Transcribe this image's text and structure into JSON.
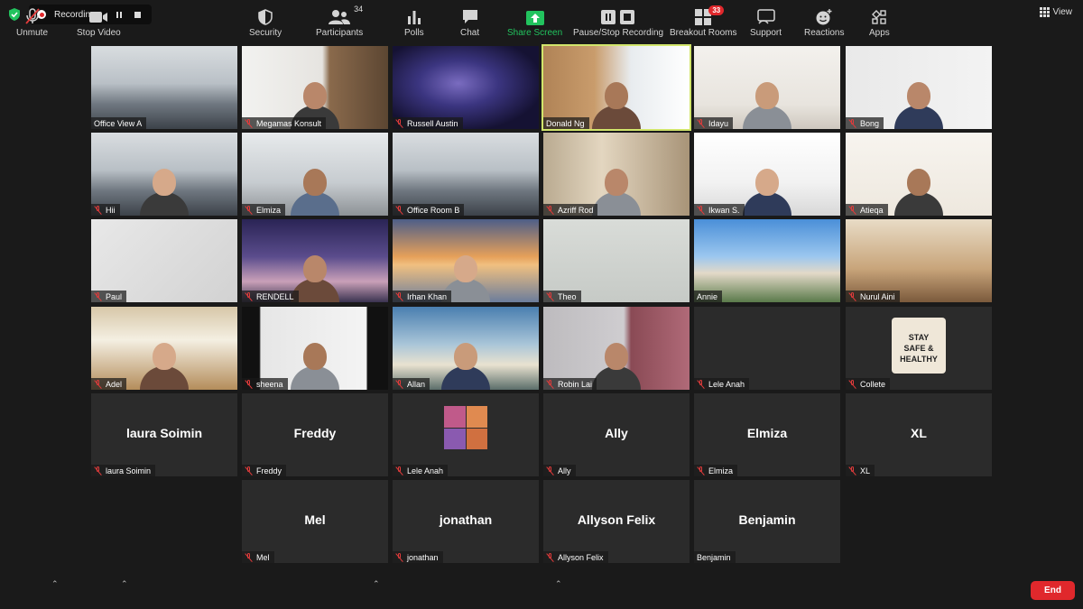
{
  "top": {
    "recording_label": "Recording...",
    "view_label": "View"
  },
  "participants": [
    {
      "name": "Office View A",
      "muted": false,
      "big": "",
      "scene": "office"
    },
    {
      "name": "Megamas Konsult",
      "muted": true,
      "big": "",
      "scene": "books"
    },
    {
      "name": "Russell Austin",
      "muted": true,
      "big": "",
      "scene": "galaxy"
    },
    {
      "name": "Donald Ng",
      "muted": false,
      "big": "",
      "scene": "man",
      "active": true
    },
    {
      "name": "Idayu",
      "muted": true,
      "big": "",
      "scene": "shelf"
    },
    {
      "name": "Bong",
      "muted": true,
      "big": "",
      "scene": "monkey"
    },
    {
      "name": "Hii",
      "muted": true,
      "big": "",
      "scene": "office"
    },
    {
      "name": "Elmiza",
      "muted": true,
      "big": "",
      "scene": "mask"
    },
    {
      "name": "Office Room B",
      "muted": true,
      "big": "",
      "scene": "office"
    },
    {
      "name": "Azriff Rod",
      "muted": true,
      "big": "",
      "scene": "street"
    },
    {
      "name": "Ikwan S.",
      "muted": true,
      "big": "",
      "scene": "white"
    },
    {
      "name": "Atieqa",
      "muted": true,
      "big": "",
      "scene": "lamps"
    },
    {
      "name": "Paul",
      "muted": true,
      "big": "",
      "scene": "ceiling"
    },
    {
      "name": "RENDELL",
      "muted": true,
      "big": "",
      "scene": "night"
    },
    {
      "name": "Irhan Khan",
      "muted": true,
      "big": "",
      "scene": "bridge"
    },
    {
      "name": "Theo",
      "muted": true,
      "big": "",
      "scene": "wall"
    },
    {
      "name": "Annie",
      "muted": false,
      "big": "",
      "scene": "villa"
    },
    {
      "name": "Nurul Aini",
      "muted": true,
      "big": "",
      "scene": "room"
    },
    {
      "name": "Adel",
      "muted": true,
      "big": "",
      "scene": "japanese"
    },
    {
      "name": "sheena",
      "muted": true,
      "big": "",
      "scene": "hijab"
    },
    {
      "name": "Allan",
      "muted": true,
      "big": "",
      "scene": "sky"
    },
    {
      "name": "Robin Lai",
      "muted": true,
      "big": "",
      "scene": "curtain"
    },
    {
      "name": "Lele Anah",
      "muted": true,
      "big": "",
      "scene": "blank"
    },
    {
      "name": "Collete",
      "muted": true,
      "big": "",
      "scene": "safe"
    },
    {
      "name": "laura Soimin",
      "muted": true,
      "big": "laura Soimin",
      "scene": "blank"
    },
    {
      "name": "Freddy",
      "muted": true,
      "big": "Freddy",
      "scene": "blank"
    },
    {
      "name": "Lele Anah",
      "muted": true,
      "big": "",
      "scene": "collage"
    },
    {
      "name": "Ally",
      "muted": true,
      "big": "Ally",
      "scene": "blank"
    },
    {
      "name": "Elmiza",
      "muted": true,
      "big": "Elmiza",
      "scene": "blank"
    },
    {
      "name": "XL",
      "muted": true,
      "big": "XL",
      "scene": "blank"
    },
    {
      "name": "Mel",
      "muted": true,
      "big": "Mel",
      "scene": "blank"
    },
    {
      "name": "jonathan",
      "muted": true,
      "big": "jonathan",
      "scene": "blank"
    },
    {
      "name": "Allyson Felix",
      "muted": true,
      "big": "Allyson Felix",
      "scene": "blank"
    },
    {
      "name": "Benjamin",
      "muted": false,
      "big": "Benjamin",
      "scene": "blank"
    }
  ],
  "safe_badge_text": "STAY SAFE & HEALTHY",
  "toolbar": {
    "unmute": "Unmute",
    "stop_video": "Stop Video",
    "security": "Security",
    "participants": "Participants",
    "participants_count": "34",
    "polls": "Polls",
    "chat": "Chat",
    "share_screen": "Share Screen",
    "pause_stop_recording": "Pause/Stop Recording",
    "breakout_rooms": "Breakout Rooms",
    "breakout_count": "33",
    "support": "Support",
    "reactions": "Reactions",
    "apps": "Apps",
    "end": "End"
  },
  "colors": {
    "active_speaker": "#d1e56b",
    "share_green": "#22c35e",
    "end_red": "#e0282c",
    "mute_red": "#e23b3b"
  }
}
